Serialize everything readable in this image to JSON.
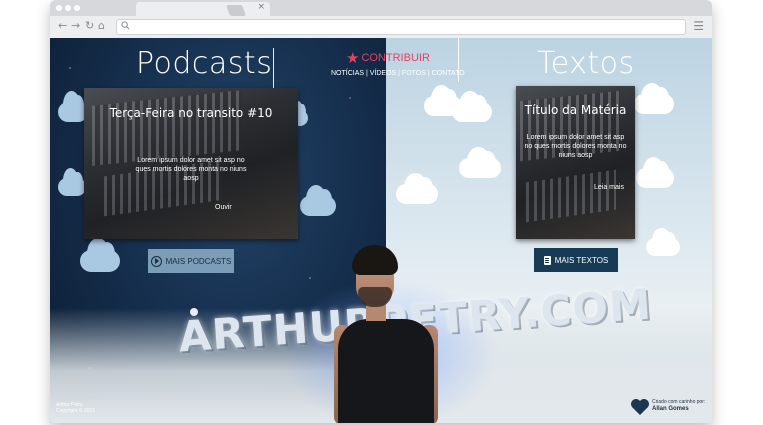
{
  "browser": {
    "tab_close": "×",
    "menu_glyph": "☰"
  },
  "nav_icons": [
    "←",
    "→",
    "↻",
    "⌂"
  ],
  "header": {
    "left_title": "Podcasts",
    "right_title": "Textos",
    "contribute_label": "CONTRIBUIR",
    "nav_links": "NOTÍCIAS | VÍDEOS | FOTOS | CONTATO"
  },
  "podcast_card": {
    "title": "Terça-Feira no transito #10",
    "body": "Lorem ipsum dolor amet sit asp no ques mortis dolores monta no niuns aosp",
    "link": "Ouvir"
  },
  "text_card": {
    "title": "Título da Matéria",
    "body": "Lorem ipsum dolor amet sit asp no ques mortis dolores monta no niuns aosp",
    "link": "Leia mais"
  },
  "buttons": {
    "more_podcasts": "MAIS PODCASTS",
    "more_texts": "MAIS TEXTOS"
  },
  "logo": {
    "text": "ARTHURPETRY.COM"
  },
  "footer": {
    "left_line1": "Arthur Petry",
    "left_line2": "Copyright © 2016",
    "right_line1": "Criado com carinho por:",
    "right_line2": "Allan Gomes"
  },
  "colors": {
    "contribute": "#e84060",
    "podcast_button": "#7b9db8",
    "texts_button": "#173a55"
  },
  "icons": {
    "contribute": "star-icon",
    "more_podcasts": "play-icon",
    "more_texts": "document-icon",
    "footer": "heart-icon"
  }
}
